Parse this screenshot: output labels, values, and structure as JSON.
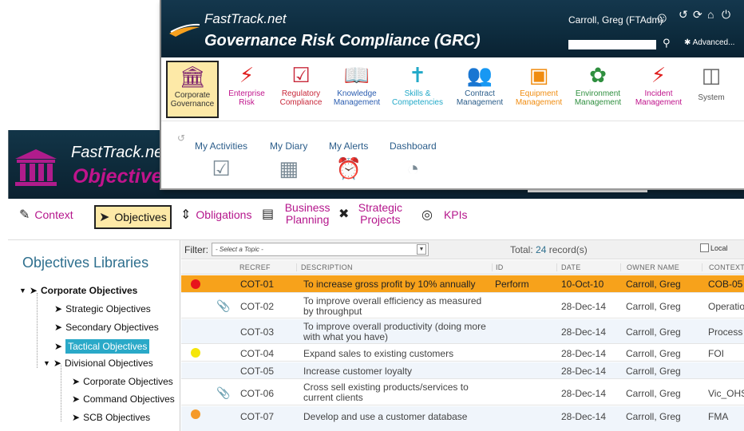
{
  "back_window": {
    "brand": "FastTrack.net",
    "app_title": "Objectives",
    "tabs": [
      {
        "label": "Context",
        "icon": "document-edit-icon",
        "active": false
      },
      {
        "label": "Objectives",
        "icon": "arrow-cursor-icon",
        "active": true
      },
      {
        "label": "Obligations",
        "icon": "updown-arrow-icon",
        "active": false
      },
      {
        "label": "Business Planning",
        "icon": "document-lines-icon",
        "active": false
      },
      {
        "label": "Strategic Projects",
        "icon": "tools-icon",
        "active": false
      },
      {
        "label": "KPIs",
        "icon": "target-icon",
        "active": false
      }
    ],
    "libraries": {
      "title": "Objectives Libraries",
      "items": [
        {
          "label": "Corporate Objectives"
        },
        {
          "label": "Strategic Objectives"
        },
        {
          "label": "Secondary Objectives"
        },
        {
          "label": "Tactical Objectives"
        },
        {
          "label": "Divisional Objectives"
        },
        {
          "label": "Corporate Objectives"
        },
        {
          "label": "Command Objectives"
        },
        {
          "label": "SCB Objectives"
        }
      ]
    },
    "grid": {
      "filter_label": "Filter:",
      "filter_placeholder": "- Select a Topic -",
      "total_prefix": "Total:",
      "total_count": "24",
      "total_suffix": "record(s)",
      "local_label": "Local",
      "columns": [
        "RECREF",
        "DESCRIPTION",
        "ID",
        "DATE",
        "OWNER NAME",
        "CONTEXT"
      ],
      "rows": [
        {
          "status": "red",
          "attachment": false,
          "recref": "COT-01",
          "description": "To increase gross profit by 10% annually",
          "id": "Perform",
          "date": "10-Oct-10",
          "owner": "Carroll, Greg",
          "context": "COB-05"
        },
        {
          "status": "",
          "attachment": true,
          "recref": "COT-02",
          "description": "To improve overall efficiency as measured by throughput",
          "id": "",
          "date": "28-Dec-14",
          "owner": "Carroll, Greg",
          "context": "Operatio"
        },
        {
          "status": "",
          "attachment": false,
          "recref": "COT-03",
          "description": "To improve overall productivity (doing more with what you have)",
          "id": "",
          "date": "28-Dec-14",
          "owner": "Carroll, Greg",
          "context": "Process"
        },
        {
          "status": "yellow",
          "attachment": false,
          "recref": "COT-04",
          "description": "Expand sales to existing customers",
          "id": "",
          "date": "28-Dec-14",
          "owner": "Carroll, Greg",
          "context": "FOI"
        },
        {
          "status": "",
          "attachment": false,
          "recref": "COT-05",
          "description": "Increase customer loyalty",
          "id": "",
          "date": "28-Dec-14",
          "owner": "Carroll, Greg",
          "context": ""
        },
        {
          "status": "",
          "attachment": true,
          "recref": "COT-06",
          "description": "Cross sell existing products/services to current clients",
          "id": "",
          "date": "28-Dec-14",
          "owner": "Carroll, Greg",
          "context": "Vic_OHS"
        },
        {
          "status": "orange",
          "attachment": false,
          "recref": "COT-07",
          "description": "Develop and use a customer database",
          "id": "",
          "date": "28-Dec-14",
          "owner": "Carroll, Greg",
          "context": "FMA"
        }
      ]
    }
  },
  "front_window": {
    "brand": "FastTrack.net",
    "app_title": "Governance Risk Compliance (GRC)",
    "user": "Carroll, Greg (FTAdm)",
    "advanced_label": "Advanced...",
    "modules": [
      {
        "label1": "Corporate",
        "label2": "Governance",
        "icon": "pillars-icon",
        "color": "#7b1f6e",
        "active": true
      },
      {
        "label1": "Enterprise",
        "label2": "Risk",
        "icon": "lightning-icon",
        "color": "#e02020",
        "active": false
      },
      {
        "label1": "Regulatory",
        "label2": "Compliance",
        "icon": "checkbox-icon",
        "color": "#c8283a",
        "active": false
      },
      {
        "label1": "Knowledge",
        "label2": "Management",
        "icon": "book-icon",
        "color": "#2b5db0",
        "active": false
      },
      {
        "label1": "Skills &",
        "label2": "Competencies",
        "icon": "person-icon",
        "color": "#22a9c8",
        "active": false
      },
      {
        "label1": "Contract",
        "label2": "Management",
        "icon": "people-icon",
        "color": "#4f6f8f",
        "active": false
      },
      {
        "label1": "Equipment",
        "label2": "Management",
        "icon": "equipment-icon",
        "color": "#f08c10",
        "active": false
      },
      {
        "label1": "Environment",
        "label2": "Management",
        "icon": "leaf-icon",
        "color": "#2f8f3f",
        "active": false
      },
      {
        "label1": "Incident",
        "label2": "Management",
        "icon": "lightning-icon",
        "color": "#e02020",
        "active": false
      },
      {
        "label1": "System",
        "label2": "",
        "icon": "toolbox-icon",
        "color": "#666666",
        "active": false
      }
    ],
    "activities": [
      {
        "label": "My Activities",
        "icon": "checklist-icon"
      },
      {
        "label": "My Diary",
        "icon": "calendar-icon"
      },
      {
        "label": "My Alerts",
        "icon": "alarm-clock-icon"
      },
      {
        "label": "Dashboard",
        "icon": "pie-chart-icon"
      }
    ]
  }
}
